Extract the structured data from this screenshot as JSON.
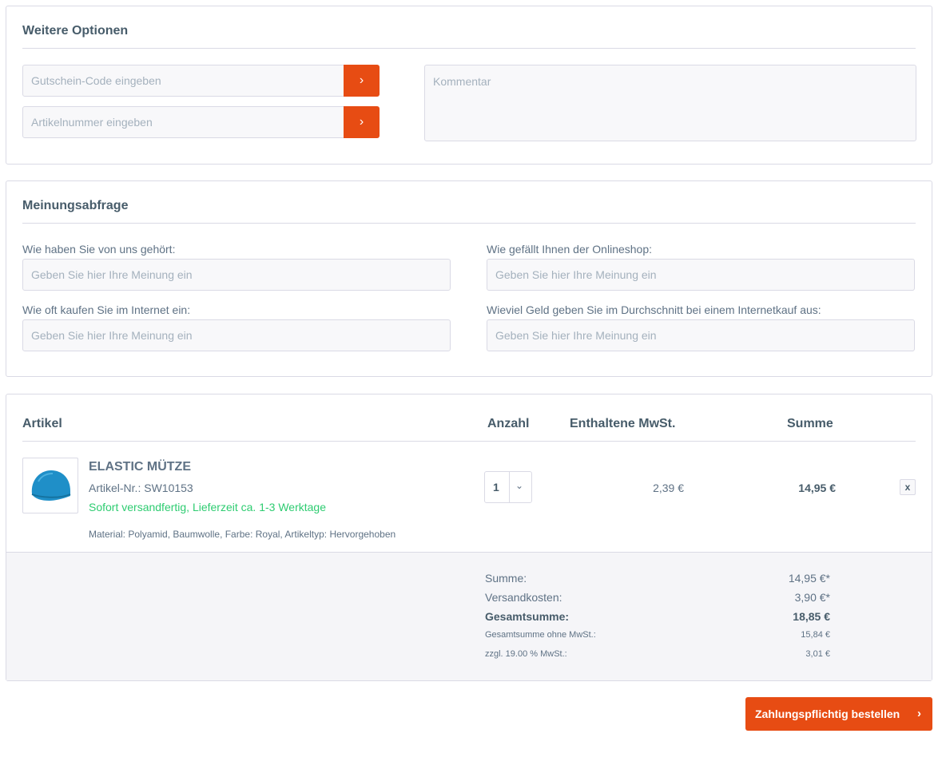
{
  "options": {
    "title": "Weitere Optionen",
    "voucher_placeholder": "Gutschein-Code eingeben",
    "article_placeholder": "Artikelnummer eingeben",
    "comment_placeholder": "Kommentar",
    "go_icon": "›"
  },
  "survey": {
    "title": "Meinungsabfrage",
    "questions": [
      {
        "label": "Wie haben Sie von uns gehört:",
        "placeholder": "Geben Sie hier Ihre Meinung ein"
      },
      {
        "label": "Wie gefällt Ihnen der Onlineshop:",
        "placeholder": "Geben Sie hier Ihre Meinung ein"
      },
      {
        "label": "Wie oft kaufen Sie im Internet ein:",
        "placeholder": "Geben Sie hier Ihre Meinung ein"
      },
      {
        "label": "Wieviel Geld geben Sie im Durchschnitt bei einem Internetkauf aus:",
        "placeholder": "Geben Sie hier Ihre Meinung ein"
      }
    ]
  },
  "cart": {
    "headers": {
      "article": "Artikel",
      "quantity": "Anzahl",
      "vat": "Enthaltene MwSt.",
      "total": "Summe"
    },
    "item": {
      "name": "ELASTIC MÜTZE",
      "sku": "Artikel-Nr.: SW10153",
      "delivery": "Sofort versandfertig, Lieferzeit ca. 1-3 Werktage",
      "details": "Material: Polyamid, Baumwolle, Farbe: Royal, Artikeltyp: Hervorgehoben",
      "quantity": "1",
      "vat": "2,39 €",
      "total": "14,95 €",
      "remove_icon": "x"
    },
    "summary": [
      {
        "label": "Summe:",
        "value": "14,95 €*"
      },
      {
        "label": "Versandkosten:",
        "value": "3,90 €*"
      },
      {
        "label": "Gesamtsumme:",
        "value": "18,85 €"
      },
      {
        "label": "Gesamtsumme ohne MwSt.:",
        "value": "15,84 €"
      },
      {
        "label": "zzgl. 19.00 % MwSt.:",
        "value": "3,01 €"
      }
    ]
  },
  "order_button": {
    "label": "Zahlungspflichtig bestellen",
    "icon": "›"
  },
  "colors": {
    "accent": "#e74c13",
    "delivery_green": "#2ecc71",
    "heading": "#475c6a",
    "text": "#5f7285",
    "border": "#dadae5"
  }
}
